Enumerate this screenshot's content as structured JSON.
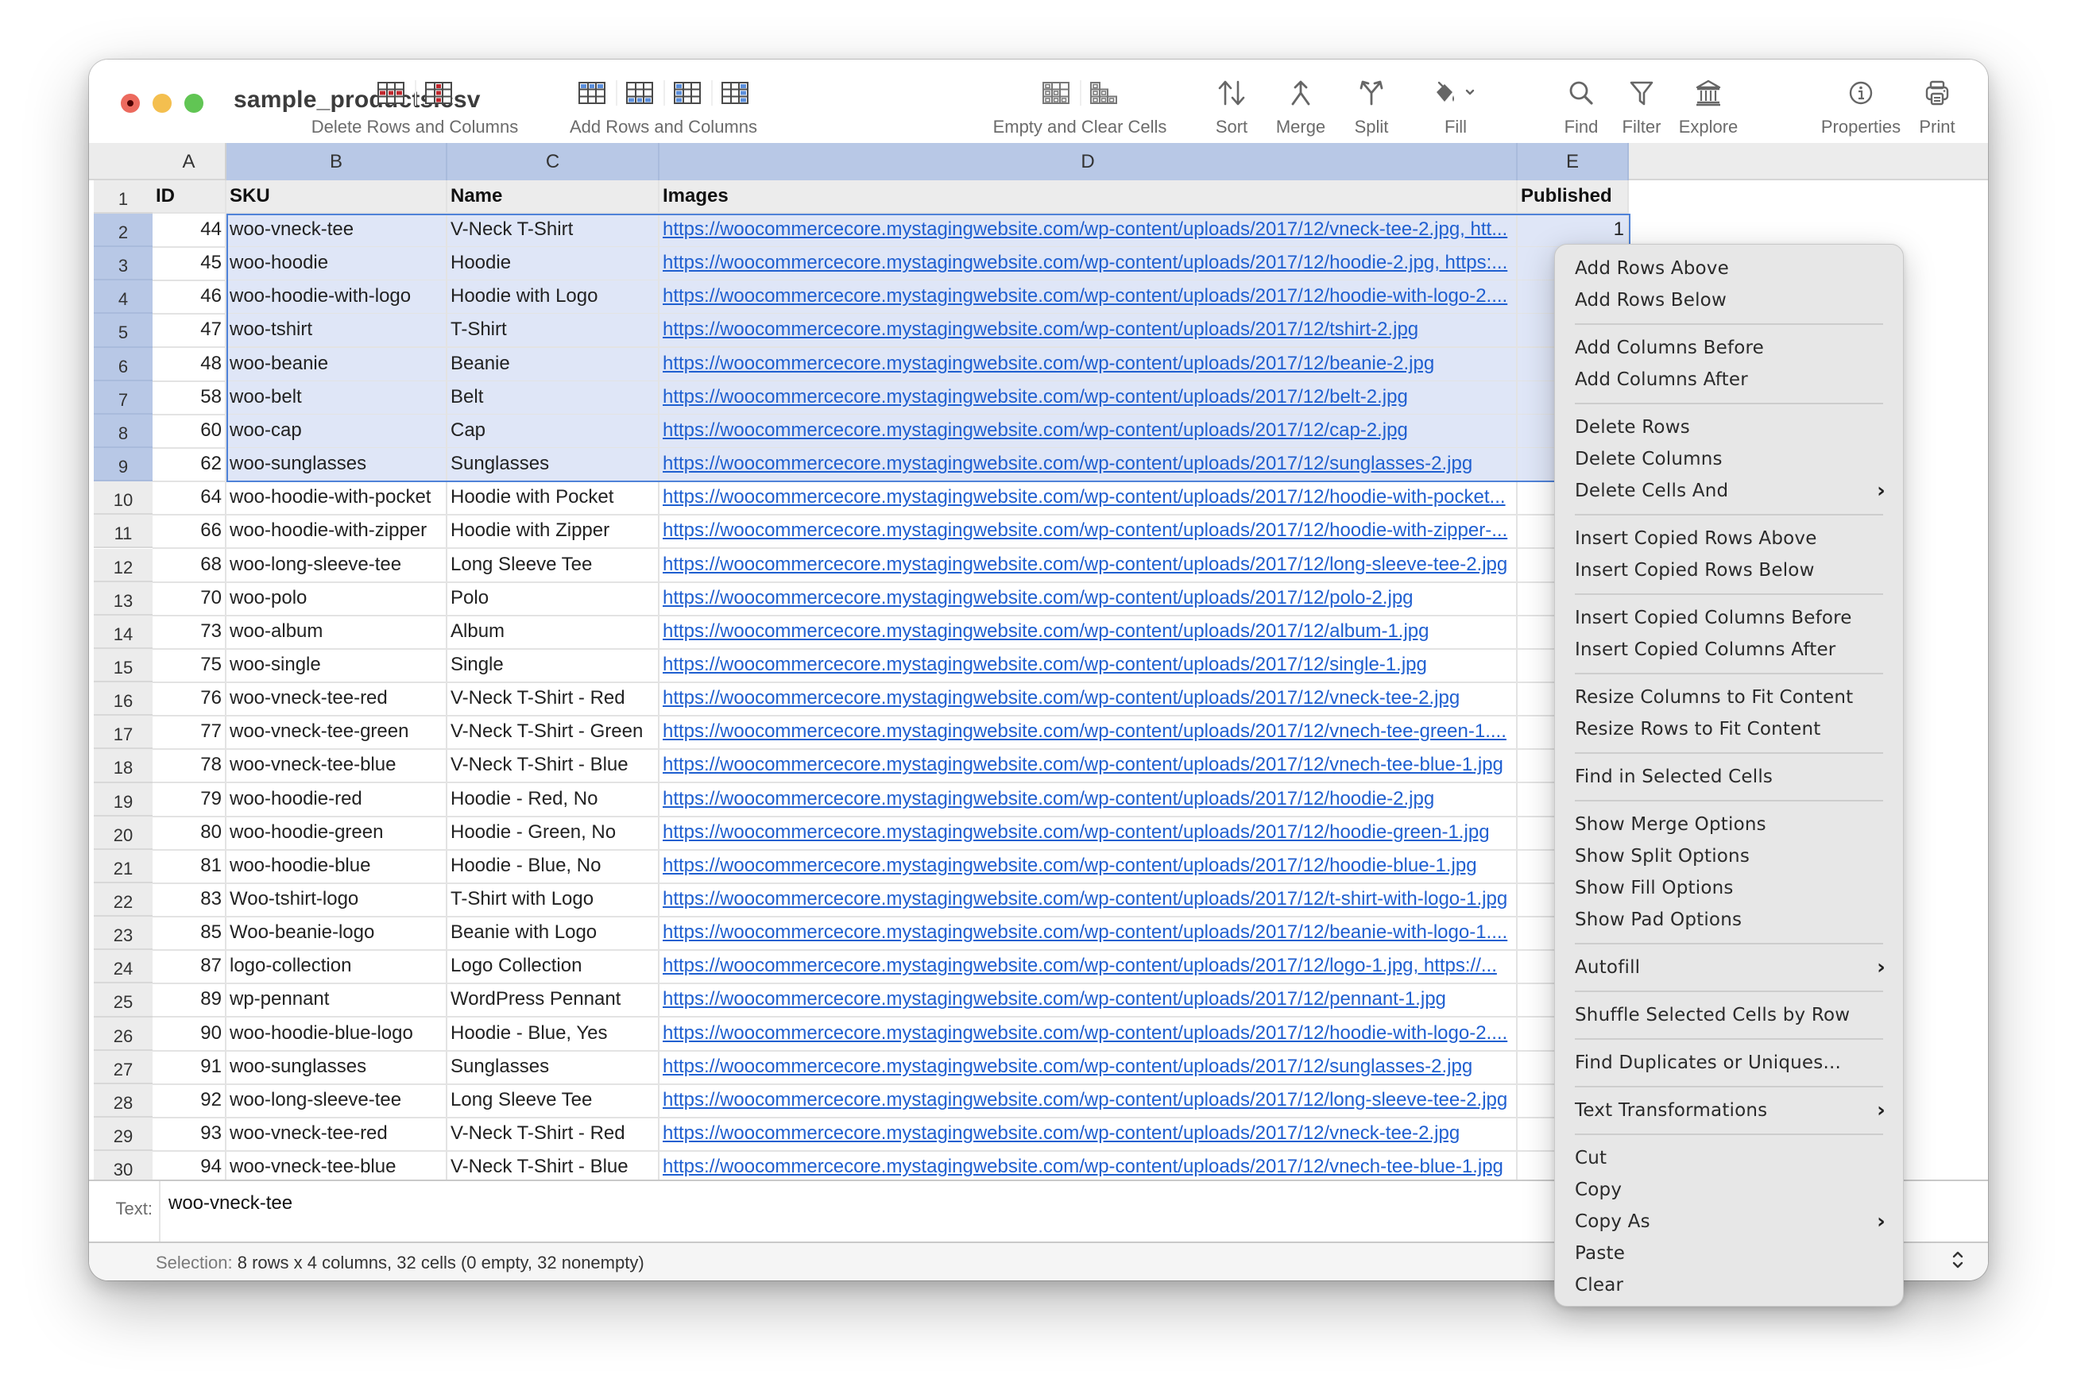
{
  "window": {
    "title": "sample_products.csv",
    "traffic_lights": [
      "close",
      "minimize",
      "zoom"
    ]
  },
  "toolbar": {
    "groups": [
      {
        "label": "Delete Rows and Columns",
        "icons": [
          "delete-row-icon",
          "delete-column-icon"
        ]
      },
      {
        "label": "Add Rows and Columns",
        "icons": [
          "add-row-above-icon",
          "add-row-below-icon",
          "add-column-before-icon",
          "add-column-after-icon"
        ]
      },
      {
        "label": "Empty and Clear Cells",
        "icons": [
          "empty-cells-icon",
          "clear-cells-icon"
        ]
      },
      {
        "label": "Sort",
        "icons": [
          "sort-icon"
        ]
      },
      {
        "label": "Merge",
        "icons": [
          "merge-icon"
        ]
      },
      {
        "label": "Split",
        "icons": [
          "split-icon"
        ]
      },
      {
        "label": "Fill",
        "icons": [
          "fill-bucket-icon"
        ]
      },
      {
        "label": "Find",
        "icons": [
          "search-icon"
        ]
      },
      {
        "label": "Filter",
        "icons": [
          "filter-icon"
        ]
      },
      {
        "label": "Explore",
        "icons": [
          "explore-icon"
        ]
      },
      {
        "label": "Properties",
        "icons": [
          "info-icon"
        ]
      },
      {
        "label": "Print",
        "icons": [
          "printer-icon"
        ]
      }
    ]
  },
  "sheet": {
    "column_letters": [
      "A",
      "B",
      "C",
      "D",
      "E"
    ],
    "selected_columns": [
      "B",
      "C",
      "D",
      "E"
    ],
    "selected_rows": [
      2,
      3,
      4,
      5,
      6,
      7,
      8,
      9
    ],
    "header_row": {
      "row": 1,
      "cells": [
        "ID",
        "SKU",
        "Name",
        "Images",
        "Published"
      ]
    },
    "rows": [
      {
        "row": 2,
        "id": "44",
        "sku": "woo-vneck-tee",
        "name": "V-Neck T-Shirt",
        "images": "https://woocommercecore.mystagingwebsite.com/wp-content/uploads/2017/12/vneck-tee-2.jpg, htt...",
        "published": "1"
      },
      {
        "row": 3,
        "id": "45",
        "sku": "woo-hoodie",
        "name": "Hoodie",
        "images": "https://woocommercecore.mystagingwebsite.com/wp-content/uploads/2017/12/hoodie-2.jpg, https:...",
        "published": ""
      },
      {
        "row": 4,
        "id": "46",
        "sku": "woo-hoodie-with-logo",
        "name": "Hoodie with Logo",
        "images": "https://woocommercecore.mystagingwebsite.com/wp-content/uploads/2017/12/hoodie-with-logo-2....",
        "published": ""
      },
      {
        "row": 5,
        "id": "47",
        "sku": "woo-tshirt",
        "name": "T-Shirt",
        "images": "https://woocommercecore.mystagingwebsite.com/wp-content/uploads/2017/12/tshirt-2.jpg",
        "published": ""
      },
      {
        "row": 6,
        "id": "48",
        "sku": "woo-beanie",
        "name": "Beanie",
        "images": "https://woocommercecore.mystagingwebsite.com/wp-content/uploads/2017/12/beanie-2.jpg",
        "published": ""
      },
      {
        "row": 7,
        "id": "58",
        "sku": "woo-belt",
        "name": "Belt",
        "images": "https://woocommercecore.mystagingwebsite.com/wp-content/uploads/2017/12/belt-2.jpg",
        "published": ""
      },
      {
        "row": 8,
        "id": "60",
        "sku": "woo-cap",
        "name": "Cap",
        "images": "https://woocommercecore.mystagingwebsite.com/wp-content/uploads/2017/12/cap-2.jpg",
        "published": ""
      },
      {
        "row": 9,
        "id": "62",
        "sku": "woo-sunglasses",
        "name": "Sunglasses",
        "images": "https://woocommercecore.mystagingwebsite.com/wp-content/uploads/2017/12/sunglasses-2.jpg",
        "published": ""
      },
      {
        "row": 10,
        "id": "64",
        "sku": "woo-hoodie-with-pocket",
        "name": "Hoodie with Pocket",
        "images": "https://woocommercecore.mystagingwebsite.com/wp-content/uploads/2017/12/hoodie-with-pocket...",
        "published": ""
      },
      {
        "row": 11,
        "id": "66",
        "sku": "woo-hoodie-with-zipper",
        "name": "Hoodie with Zipper",
        "images": "https://woocommercecore.mystagingwebsite.com/wp-content/uploads/2017/12/hoodie-with-zipper-...",
        "published": ""
      },
      {
        "row": 12,
        "id": "68",
        "sku": "woo-long-sleeve-tee",
        "name": "Long Sleeve Tee",
        "images": "https://woocommercecore.mystagingwebsite.com/wp-content/uploads/2017/12/long-sleeve-tee-2.jpg",
        "published": ""
      },
      {
        "row": 13,
        "id": "70",
        "sku": "woo-polo",
        "name": "Polo",
        "images": "https://woocommercecore.mystagingwebsite.com/wp-content/uploads/2017/12/polo-2.jpg",
        "published": ""
      },
      {
        "row": 14,
        "id": "73",
        "sku": "woo-album",
        "name": "Album",
        "images": "https://woocommercecore.mystagingwebsite.com/wp-content/uploads/2017/12/album-1.jpg",
        "published": ""
      },
      {
        "row": 15,
        "id": "75",
        "sku": "woo-single",
        "name": "Single",
        "images": "https://woocommercecore.mystagingwebsite.com/wp-content/uploads/2017/12/single-1.jpg",
        "published": ""
      },
      {
        "row": 16,
        "id": "76",
        "sku": "woo-vneck-tee-red",
        "name": "V-Neck T-Shirt - Red",
        "images": "https://woocommercecore.mystagingwebsite.com/wp-content/uploads/2017/12/vneck-tee-2.jpg",
        "published": ""
      },
      {
        "row": 17,
        "id": "77",
        "sku": "woo-vneck-tee-green",
        "name": "V-Neck T-Shirt - Green",
        "images": "https://woocommercecore.mystagingwebsite.com/wp-content/uploads/2017/12/vnech-tee-green-1....",
        "published": ""
      },
      {
        "row": 18,
        "id": "78",
        "sku": "woo-vneck-tee-blue",
        "name": "V-Neck T-Shirt - Blue",
        "images": "https://woocommercecore.mystagingwebsite.com/wp-content/uploads/2017/12/vnech-tee-blue-1.jpg",
        "published": ""
      },
      {
        "row": 19,
        "id": "79",
        "sku": "woo-hoodie-red",
        "name": "Hoodie - Red, No",
        "images": "https://woocommercecore.mystagingwebsite.com/wp-content/uploads/2017/12/hoodie-2.jpg",
        "published": ""
      },
      {
        "row": 20,
        "id": "80",
        "sku": "woo-hoodie-green",
        "name": "Hoodie - Green, No",
        "images": "https://woocommercecore.mystagingwebsite.com/wp-content/uploads/2017/12/hoodie-green-1.jpg",
        "published": ""
      },
      {
        "row": 21,
        "id": "81",
        "sku": "woo-hoodie-blue",
        "name": "Hoodie - Blue, No",
        "images": "https://woocommercecore.mystagingwebsite.com/wp-content/uploads/2017/12/hoodie-blue-1.jpg",
        "published": ""
      },
      {
        "row": 22,
        "id": "83",
        "sku": "Woo-tshirt-logo",
        "name": "T-Shirt with Logo",
        "images": "https://woocommercecore.mystagingwebsite.com/wp-content/uploads/2017/12/t-shirt-with-logo-1.jpg",
        "published": ""
      },
      {
        "row": 23,
        "id": "85",
        "sku": "Woo-beanie-logo",
        "name": "Beanie with Logo",
        "images": "https://woocommercecore.mystagingwebsite.com/wp-content/uploads/2017/12/beanie-with-logo-1....",
        "published": ""
      },
      {
        "row": 24,
        "id": "87",
        "sku": "logo-collection",
        "name": "Logo Collection",
        "images": "https://woocommercecore.mystagingwebsite.com/wp-content/uploads/2017/12/logo-1.jpg, https://...",
        "published": ""
      },
      {
        "row": 25,
        "id": "89",
        "sku": "wp-pennant",
        "name": "WordPress Pennant",
        "images": "https://woocommercecore.mystagingwebsite.com/wp-content/uploads/2017/12/pennant-1.jpg",
        "published": ""
      },
      {
        "row": 26,
        "id": "90",
        "sku": "woo-hoodie-blue-logo",
        "name": "Hoodie - Blue, Yes",
        "images": "https://woocommercecore.mystagingwebsite.com/wp-content/uploads/2017/12/hoodie-with-logo-2....",
        "published": ""
      },
      {
        "row": 27,
        "id": "91",
        "sku": "woo-sunglasses",
        "name": "Sunglasses",
        "images": "https://woocommercecore.mystagingwebsite.com/wp-content/uploads/2017/12/sunglasses-2.jpg",
        "published": ""
      },
      {
        "row": 28,
        "id": "92",
        "sku": "woo-long-sleeve-tee",
        "name": "Long Sleeve Tee",
        "images": "https://woocommercecore.mystagingwebsite.com/wp-content/uploads/2017/12/long-sleeve-tee-2.jpg",
        "published": ""
      },
      {
        "row": 29,
        "id": "93",
        "sku": "woo-vneck-tee-red",
        "name": "V-Neck T-Shirt - Red",
        "images": "https://woocommercecore.mystagingwebsite.com/wp-content/uploads/2017/12/vneck-tee-2.jpg",
        "published": ""
      },
      {
        "row": 30,
        "id": "94",
        "sku": "woo-vneck-tee-blue",
        "name": "V-Neck T-Shirt - Blue",
        "images": "https://woocommercecore.mystagingwebsite.com/wp-content/uploads/2017/12/vnech-tee-blue-1.jpg",
        "published": ""
      }
    ]
  },
  "text_bar": {
    "label": "Text:",
    "value": "woo-vneck-tee"
  },
  "status_bar": {
    "label": "Selection:",
    "value": "8 rows x 4 columns, 32 cells (0 empty, 32 nonempty)"
  },
  "context_menu": {
    "sections": [
      [
        {
          "label": "Add Rows Above"
        },
        {
          "label": "Add Rows Below"
        }
      ],
      [
        {
          "label": "Add Columns Before"
        },
        {
          "label": "Add Columns After"
        }
      ],
      [
        {
          "label": "Delete Rows"
        },
        {
          "label": "Delete Columns"
        },
        {
          "label": "Delete Cells And",
          "submenu": true
        }
      ],
      [
        {
          "label": "Insert Copied Rows Above"
        },
        {
          "label": "Insert Copied Rows Below"
        }
      ],
      [
        {
          "label": "Insert Copied Columns Before"
        },
        {
          "label": "Insert Copied Columns After"
        }
      ],
      [
        {
          "label": "Resize Columns to Fit Content"
        },
        {
          "label": "Resize Rows to Fit Content"
        }
      ],
      [
        {
          "label": "Find in Selected Cells"
        }
      ],
      [
        {
          "label": "Show Merge Options"
        },
        {
          "label": "Show Split Options"
        },
        {
          "label": "Show Fill Options"
        },
        {
          "label": "Show Pad Options"
        }
      ],
      [
        {
          "label": "Autofill",
          "submenu": true
        }
      ],
      [
        {
          "label": "Shuffle Selected Cells by Row"
        }
      ],
      [
        {
          "label": "Find Duplicates or Uniques..."
        }
      ],
      [
        {
          "label": "Text Transformations",
          "submenu": true
        }
      ],
      [
        {
          "label": "Cut"
        },
        {
          "label": "Copy"
        },
        {
          "label": "Copy As",
          "submenu": true
        },
        {
          "label": "Paste"
        },
        {
          "label": "Clear"
        }
      ]
    ]
  },
  "colors": {
    "selection_header": "#b8c8e6",
    "selection_fill": "#dfe6f7",
    "selection_border": "#4f82d8",
    "link": "#1f5fd0",
    "delete_icon_accent": "#c0272d",
    "add_icon_accent": "#5b8fdc"
  }
}
